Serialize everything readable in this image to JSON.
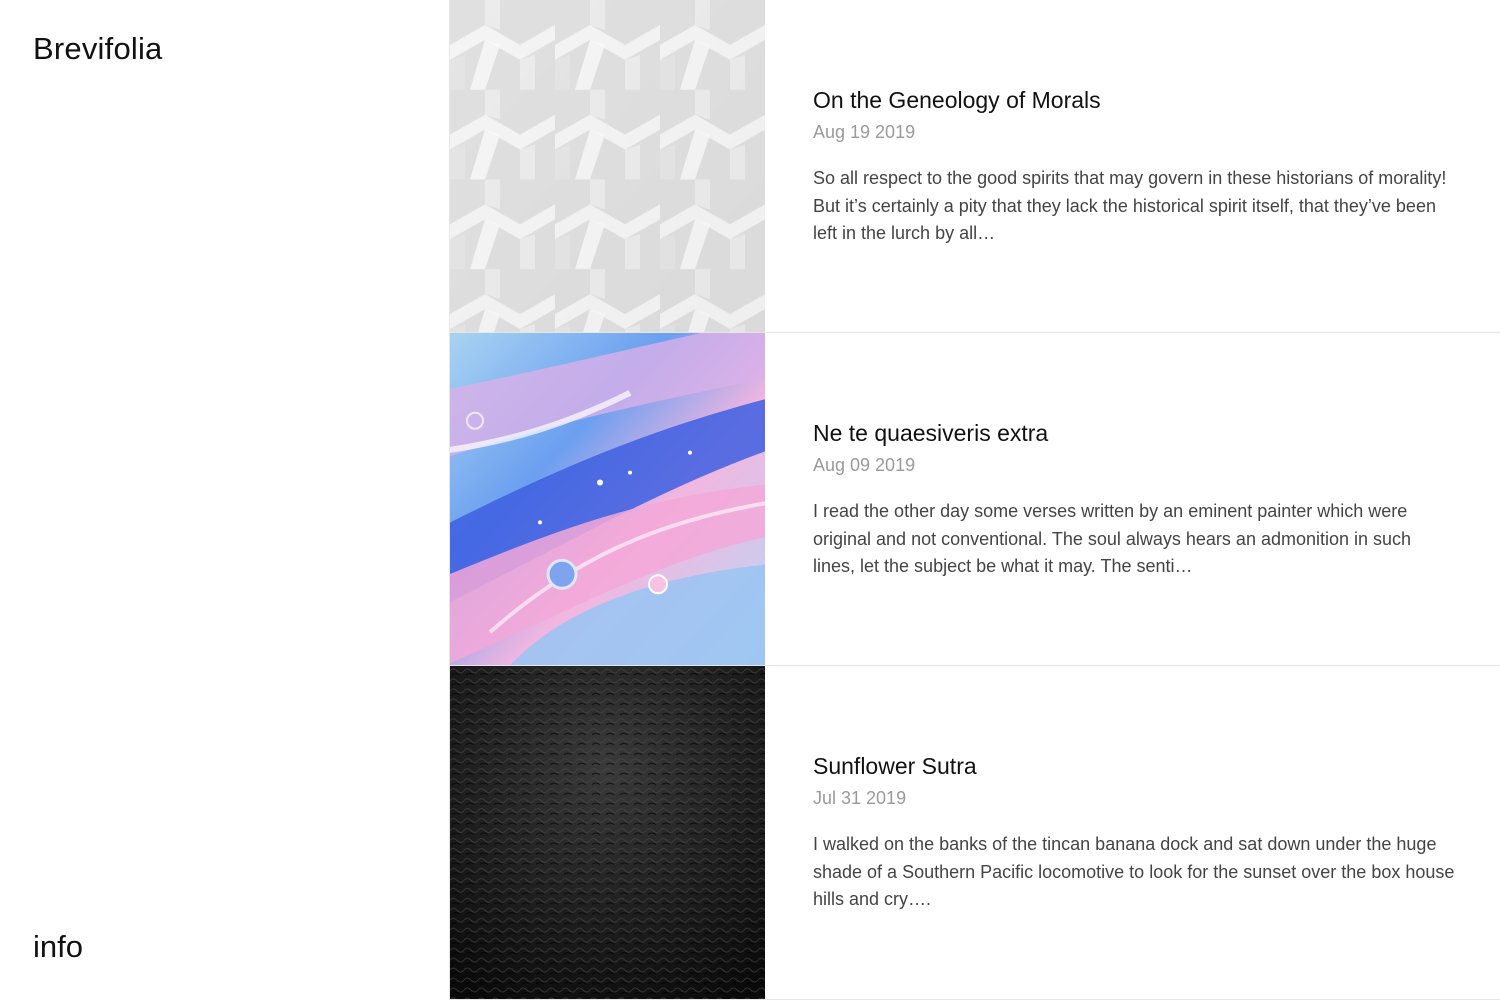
{
  "site": {
    "title": "Brevifolia",
    "info_label": "info"
  },
  "posts": [
    {
      "title": "On the Geneology of Morals",
      "date": "Aug 19 2019",
      "excerpt": "So all respect to the good spirits that may govern in these historians of morality! But it’s certainly a pity that they lack the historical spirit itself, that they’ve been left in the lurch by all…",
      "image": "white-woven-pattern"
    },
    {
      "title": "Ne te quaesiveris extra",
      "date": "Aug 09 2019",
      "excerpt": "I read the other day some verses written by an eminent painter which were original and not conventional. The soul always hears an admonition in such lines, let the subject be what it may. The senti…",
      "image": "blue-pink-marble-paint"
    },
    {
      "title": "Sunflower Sutra",
      "date": "Jul 31 2019",
      "excerpt": "I walked on the banks of the tincan banana dock and sat down under the huge shade of a Southern Pacific locomotive to look for the sunset over the box house hills and cry….",
      "image": "black-leather-texture"
    }
  ],
  "colors": {
    "text": "#111111",
    "date": "#9a9a9a",
    "excerpt": "#444444",
    "divider": "#e6e6e6"
  }
}
